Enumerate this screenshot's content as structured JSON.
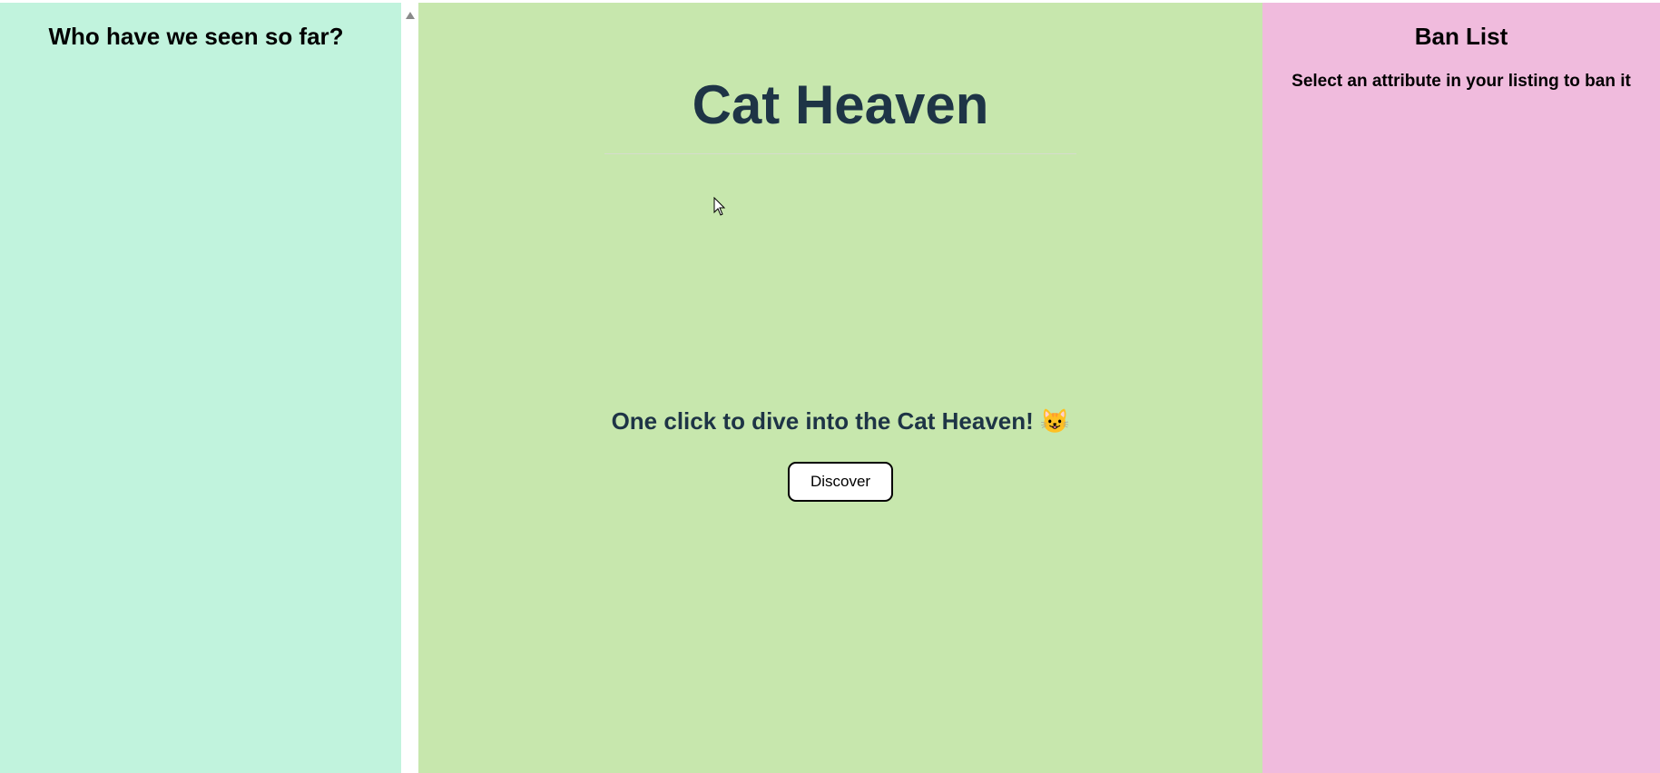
{
  "history": {
    "title": "Who have we seen so far?"
  },
  "main": {
    "title": "Cat Heaven",
    "tagline": "One click to dive into the Cat Heaven! 😺",
    "discover_label": "Discover"
  },
  "ban": {
    "title": "Ban List",
    "subtitle": "Select an attribute in your listing to ban it"
  },
  "colors": {
    "history_bg": "#c1f3dd",
    "main_bg": "#c7e7ad",
    "ban_bg": "#f0bbdd",
    "heading_text": "#1e3446"
  }
}
